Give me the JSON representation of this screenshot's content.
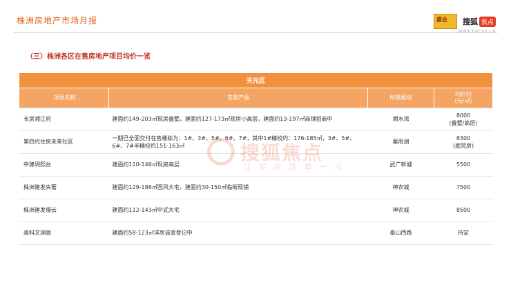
{
  "header": {
    "title": "株洲房地产市场月报",
    "logo_a": "盛业",
    "logo_b_main": "搜狐",
    "logo_b_badge": "焦点",
    "logo_b_sub": "WWW.FOCUS.CN"
  },
  "section_title": "（三）株洲各区在售房地产项目均价一览",
  "watermark": {
    "brand": "搜狐焦点",
    "slogan": "让买房简单一点"
  },
  "chart_data": {
    "type": "table",
    "title": "天元区",
    "columns": [
      "项目名称",
      "在售产品",
      "所属板块",
      "均价约\n（元/㎡）"
    ],
    "rows": [
      [
        "长房湘江府",
        "建面约149-203㎡现房叠墅，建面约127-173㎡现房小高层，建面约13-197㎡商铺招商中",
        "湘水湾",
        "8000\n(叠墅/高层)"
      ],
      [
        "第四代住房未来社区",
        "一期已全面交付在售楼栋为：1#、3#、5#、6#、7#，其中1#精校约：176-185㎡，3#、5#、6#、7#半精校约151-163㎡",
        "栗雨湖",
        "8300\n(庭院房)"
      ],
      [
        "中建玥熙台",
        "建面约110-146㎡现房高层",
        "武广新城",
        "5500"
      ],
      [
        "株洲建发央著",
        "建面约129-188㎡国风大宅，建面约30-150㎡临街现铺",
        "神农城",
        "7500"
      ],
      [
        "株洲建发缦云",
        "建面约112-143㎡中式大宅",
        "神农城",
        "8500"
      ],
      [
        "高科文渊阁",
        "建面约58-123㎡洋房诚意登记中",
        "泰山西路",
        "待定"
      ]
    ]
  }
}
